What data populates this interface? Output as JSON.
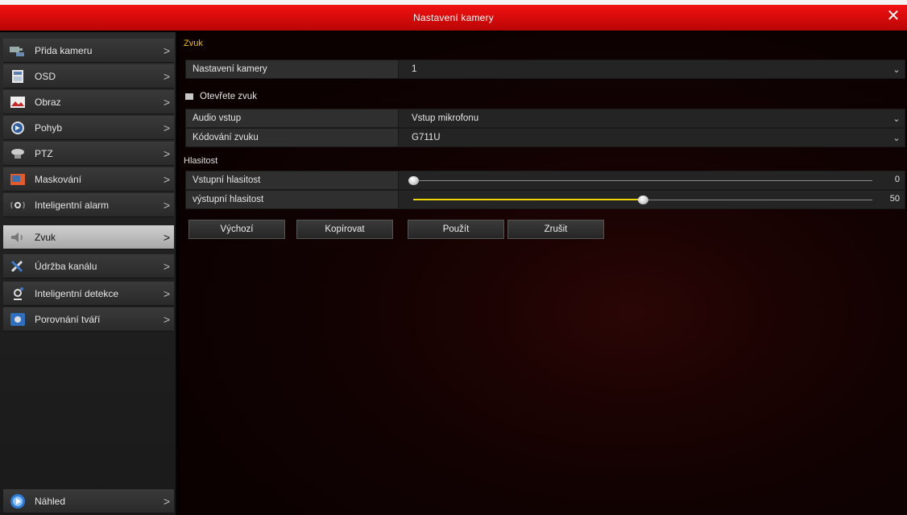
{
  "window": {
    "title": "Nastavení kamery",
    "close_symbol": "✕"
  },
  "sidebar": {
    "items": [
      {
        "label": "Přida kameru",
        "icon": "camera-icon"
      },
      {
        "label": "OSD",
        "icon": "osd-icon"
      },
      {
        "label": "Obraz",
        "icon": "image-icon"
      },
      {
        "label": "Pohyb",
        "icon": "motion-icon"
      },
      {
        "label": "PTZ",
        "icon": "ptz-icon"
      },
      {
        "label": "Maskování",
        "icon": "mask-icon"
      },
      {
        "label": "Inteligentní alarm",
        "icon": "alarm-icon"
      },
      {
        "label": "Zvuk",
        "icon": "speaker-icon",
        "active": true
      },
      {
        "label": "Údržba kanálu",
        "icon": "tools-icon"
      },
      {
        "label": "Inteligentní detekce",
        "icon": "detection-icon"
      },
      {
        "label": "Porovnání tváří",
        "icon": "face-icon"
      }
    ],
    "bottom_item": {
      "label": "Náhled",
      "icon": "preview-icon"
    },
    "chevron": ">"
  },
  "main": {
    "section_title": "Zvuk",
    "camera_setting": {
      "label": "Nastavení kamery",
      "value": "1"
    },
    "open_audio": {
      "label": "Otevřete zvuk",
      "checked": false
    },
    "audio_input": {
      "label": "Audio vstup",
      "value": "Vstup mikrofonu"
    },
    "audio_encoding": {
      "label": "Kódování zvuku",
      "value": "G711U"
    },
    "volume_section": "Hlasitost",
    "input_volume": {
      "label": "Vstupní hlasitost",
      "value": 0,
      "display": "0",
      "max": 100
    },
    "output_volume": {
      "label": "výstupní hlasitost",
      "value": 50,
      "display": "50",
      "max": 100
    },
    "buttons": {
      "default": "Výchozí",
      "copy": "Kopírovat",
      "apply": "Použít",
      "cancel": "Zrušit"
    },
    "dropdown_symbol": "⌄"
  },
  "colors": {
    "titlebar": "#d40a0a",
    "section_accent": "#f0c000",
    "slider_fill": "#f2d600"
  }
}
